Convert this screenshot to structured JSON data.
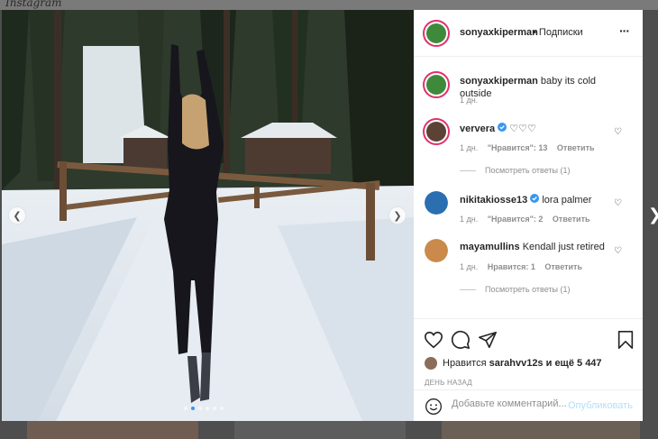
{
  "post": {
    "username": "sonyaxkiperman",
    "follow_label": "• Подписки",
    "more_icon": "more-horizontal-icon",
    "caption_text": "baby its cold outside",
    "caption_time": "1 дн.",
    "photo_dots_count": 6,
    "photo_active_dot": 1
  },
  "comments": [
    {
      "username": "ververa",
      "verified": true,
      "text": "♡♡♡",
      "time": "1 дн.",
      "likes": "\"Нравится\": 13",
      "reply": "Ответить",
      "view_replies": "Посмотреть ответы (1)"
    },
    {
      "username": "nikitakiosse13",
      "verified": true,
      "text": "lora palmer",
      "time": "1 дн.",
      "likes": "\"Нравится\": 2",
      "reply": "Ответить"
    },
    {
      "username": "mayamullins",
      "verified": false,
      "text": "Kendall just retired",
      "time": "1 дн.",
      "likes": "Нравится: 1",
      "reply": "Ответить",
      "view_replies": "Посмотреть ответы (1)"
    }
  ],
  "actions": {
    "liked_by_prefix": "Нравится",
    "liked_by_user": "sarahvv12s",
    "liked_by_suffix": "и ещё 5 447",
    "date": "ДЕНЬ НАЗАД"
  },
  "composer": {
    "placeholder": "Добавьте комментарий...",
    "publish_label": "Опубликовать"
  },
  "colors": {
    "accent": "#3897f0",
    "verified": "#3897f0",
    "story_ring": "#e1306c",
    "publish_disabled": "#b2dffc"
  }
}
